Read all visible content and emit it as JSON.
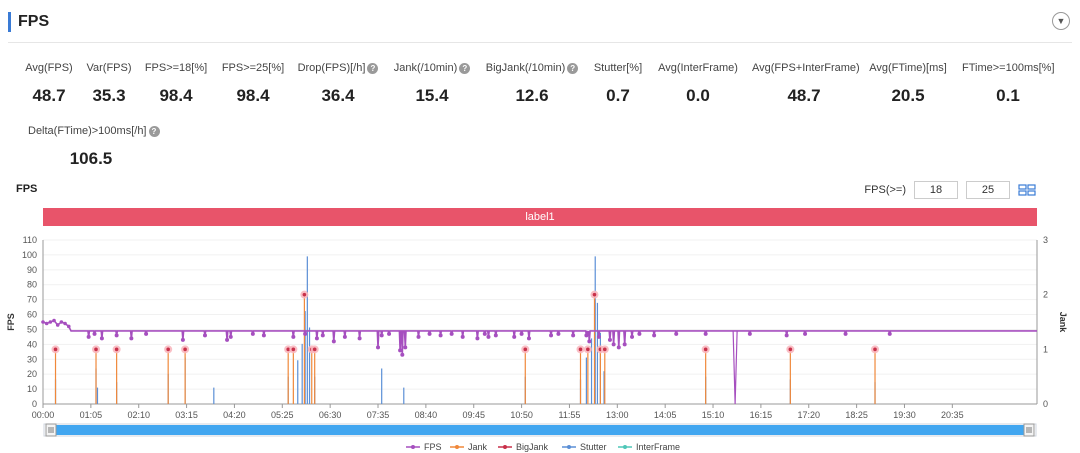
{
  "header": {
    "title": "FPS",
    "toggle_icon": "chevron-down-icon"
  },
  "metrics_row1": [
    {
      "label": "Avg(FPS)",
      "value": "48.7",
      "help": false
    },
    {
      "label": "Var(FPS)",
      "value": "35.3",
      "help": false
    },
    {
      "label": "FPS>=18[%]",
      "value": "98.4",
      "help": false
    },
    {
      "label": "FPS>=25[%]",
      "value": "98.4",
      "help": false
    },
    {
      "label": "Drop(FPS)[/h]",
      "value": "36.4",
      "help": true
    },
    {
      "label": "Jank(/10min)",
      "value": "15.4",
      "help": true
    },
    {
      "label": "BigJank(/10min)",
      "value": "12.6",
      "help": true
    },
    {
      "label": "Stutter[%]",
      "value": "0.7",
      "help": false
    },
    {
      "label": "Avg(InterFrame)",
      "value": "0.0",
      "help": false
    },
    {
      "label": "Avg(FPS+InterFrame)",
      "value": "48.7",
      "help": false
    },
    {
      "label": "Avg(FTime)[ms]",
      "value": "20.5",
      "help": false
    },
    {
      "label": "FTime>=100ms[%]",
      "value": "0.1",
      "help": false
    }
  ],
  "metrics_row2": [
    {
      "label": "Delta(FTime)>100ms[/h]",
      "value": "106.5",
      "help": true
    }
  ],
  "help_glyph": "?",
  "chart_panel": {
    "title": "FPS",
    "threshold_label": "FPS(>=)",
    "threshold_low": "18",
    "threshold_high": "25",
    "download_icon": "data-view-icon",
    "label_band": "label1"
  },
  "chart_data": {
    "type": "line",
    "title": "",
    "ylabel": "FPS",
    "y2label": "Jank",
    "ylim": [
      0,
      110
    ],
    "y2lim": [
      0,
      3
    ],
    "yticks": [
      0,
      10,
      20,
      30,
      40,
      50,
      60,
      70,
      80,
      90,
      100,
      110
    ],
    "y2ticks": [
      0,
      1,
      2,
      3
    ],
    "x_range_seconds": [
      0,
      1350
    ],
    "xticks": [
      "00:00",
      "01:05",
      "02:10",
      "03:15",
      "04:20",
      "05:25",
      "06:30",
      "07:35",
      "08:40",
      "09:45",
      "10:50",
      "11:55",
      "13:00",
      "14:05",
      "15:10",
      "16:15",
      "17:20",
      "18:25",
      "19:30",
      "20:35"
    ],
    "colors": {
      "FPS": "#a64fbf",
      "Jank": "#f0883a",
      "BigJank": "#c9304a",
      "Stutter": "#5b8fd6",
      "InterFrame": "#4fc7b8"
    },
    "fps_baseline": 49,
    "fps_start": {
      "t": [
        0,
        5,
        10,
        15,
        20,
        25,
        30,
        35
      ],
      "v": [
        55,
        54,
        55,
        56,
        53,
        55,
        54,
        52
      ]
    },
    "fps_dips": [
      {
        "t": 62,
        "v": 45
      },
      {
        "t": 70,
        "v": 47
      },
      {
        "t": 80,
        "v": 44
      },
      {
        "t": 100,
        "v": 46
      },
      {
        "t": 120,
        "v": 44
      },
      {
        "t": 140,
        "v": 47
      },
      {
        "t": 190,
        "v": 43
      },
      {
        "t": 220,
        "v": 46
      },
      {
        "t": 250,
        "v": 43
      },
      {
        "t": 255,
        "v": 45
      },
      {
        "t": 285,
        "v": 47
      },
      {
        "t": 300,
        "v": 46
      },
      {
        "t": 340,
        "v": 45
      },
      {
        "t": 356,
        "v": 47
      },
      {
        "t": 372,
        "v": 44
      },
      {
        "t": 380,
        "v": 46
      },
      {
        "t": 395,
        "v": 42
      },
      {
        "t": 410,
        "v": 45
      },
      {
        "t": 430,
        "v": 44
      },
      {
        "t": 455,
        "v": 38
      },
      {
        "t": 460,
        "v": 46
      },
      {
        "t": 470,
        "v": 47
      },
      {
        "t": 510,
        "v": 45
      },
      {
        "t": 525,
        "v": 47
      },
      {
        "t": 540,
        "v": 46
      },
      {
        "t": 555,
        "v": 47
      },
      {
        "t": 570,
        "v": 45
      },
      {
        "t": 590,
        "v": 44
      },
      {
        "t": 600,
        "v": 47
      },
      {
        "t": 605,
        "v": 45
      },
      {
        "t": 615,
        "v": 46
      },
      {
        "t": 640,
        "v": 45
      },
      {
        "t": 650,
        "v": 47
      },
      {
        "t": 660,
        "v": 44
      },
      {
        "t": 690,
        "v": 46
      },
      {
        "t": 700,
        "v": 47
      },
      {
        "t": 720,
        "v": 46
      },
      {
        "t": 740,
        "v": 47
      },
      {
        "t": 755,
        "v": 45
      },
      {
        "t": 770,
        "v": 43
      },
      {
        "t": 775,
        "v": 40
      },
      {
        "t": 782,
        "v": 38
      },
      {
        "t": 790,
        "v": 40
      },
      {
        "t": 800,
        "v": 45
      },
      {
        "t": 810,
        "v": 47
      },
      {
        "t": 830,
        "v": 46
      },
      {
        "t": 860,
        "v": 47
      },
      {
        "t": 900,
        "v": 47
      },
      {
        "t": 960,
        "v": 47
      },
      {
        "t": 1010,
        "v": 46
      },
      {
        "t": 1035,
        "v": 47
      },
      {
        "t": 1090,
        "v": 47
      },
      {
        "t": 1150,
        "v": 47
      }
    ],
    "fps_troughs": [
      {
        "t": 485,
        "v": 36
      },
      {
        "t": 488,
        "v": 33
      },
      {
        "t": 492,
        "v": 38
      },
      {
        "t": 738,
        "v": 46
      },
      {
        "t": 742,
        "v": 42
      }
    ],
    "fps_dropline": {
      "t": 940,
      "v": 0
    },
    "jank_events": [
      {
        "t": 17,
        "j": 1
      },
      {
        "t": 72,
        "j": 1
      },
      {
        "t": 100,
        "j": 1
      },
      {
        "t": 170,
        "j": 1
      },
      {
        "t": 193,
        "j": 1
      },
      {
        "t": 333,
        "j": 1
      },
      {
        "t": 340,
        "j": 1
      },
      {
        "t": 355,
        "j": 2
      },
      {
        "t": 365,
        "j": 1
      },
      {
        "t": 369,
        "j": 1
      },
      {
        "t": 655,
        "j": 1
      },
      {
        "t": 730,
        "j": 1
      },
      {
        "t": 740,
        "j": 1
      },
      {
        "t": 749,
        "j": 2
      },
      {
        "t": 757,
        "j": 1
      },
      {
        "t": 763,
        "j": 1
      },
      {
        "t": 900,
        "j": 1
      },
      {
        "t": 1015,
        "j": 1
      },
      {
        "t": 1130,
        "j": 1
      }
    ],
    "stutter_events": [
      {
        "t": 17,
        "j": 0.45
      },
      {
        "t": 72,
        "j": 0.65
      },
      {
        "t": 74,
        "j": 0.3
      },
      {
        "t": 100,
        "j": 0.4
      },
      {
        "t": 170,
        "j": 0.55
      },
      {
        "t": 193,
        "j": 0.85
      },
      {
        "t": 232,
        "j": 0.3
      },
      {
        "t": 333,
        "j": 0.5
      },
      {
        "t": 346,
        "j": 0.8
      },
      {
        "t": 352,
        "j": 1.1
      },
      {
        "t": 356,
        "j": 1.7
      },
      {
        "t": 359,
        "j": 2.7
      },
      {
        "t": 362,
        "j": 1.4
      },
      {
        "t": 369,
        "j": 0.5
      },
      {
        "t": 460,
        "j": 0.65
      },
      {
        "t": 490,
        "j": 0.3
      },
      {
        "t": 655,
        "j": 0.5
      },
      {
        "t": 730,
        "j": 0.45
      },
      {
        "t": 738,
        "j": 0.85
      },
      {
        "t": 745,
        "j": 1.2
      },
      {
        "t": 750,
        "j": 2.7
      },
      {
        "t": 753,
        "j": 1.85
      },
      {
        "t": 757,
        "j": 1.3
      },
      {
        "t": 762,
        "j": 0.6
      },
      {
        "t": 900,
        "j": 0.5
      },
      {
        "t": 1015,
        "j": 0.45
      },
      {
        "t": 1130,
        "j": 0.4
      }
    ],
    "legend": [
      "FPS",
      "Jank",
      "BigJank",
      "Stutter",
      "InterFrame"
    ]
  }
}
